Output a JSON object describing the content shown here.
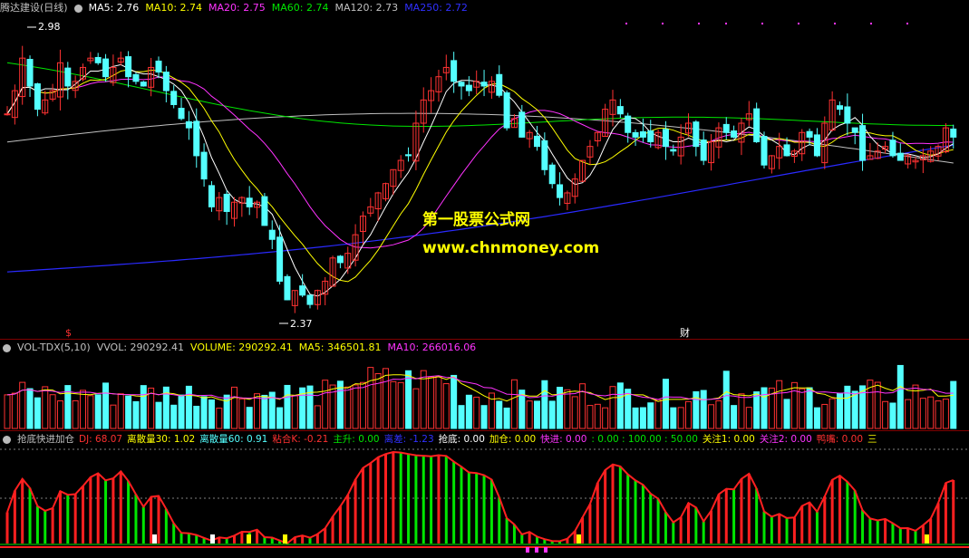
{
  "colors": {
    "up": "#ff3232",
    "down": "#54ffff",
    "white": "#ffffff",
    "yellow": "#ffff00",
    "magenta": "#ff33ff",
    "green": "#00e600",
    "blue": "#2a2aff",
    "grid": "#7f0000",
    "red": "#ff2020",
    "gray": "#c0c0c0"
  },
  "main": {
    "stock": "腾达建设(日线)",
    "ma_labels": [
      "MA5: 2.76",
      "MA10: 2.74",
      "MA20: 2.75",
      "MA60: 2.74",
      "MA120: 2.73",
      "MA250: 2.72"
    ],
    "high_label": "2.98",
    "low_label": "2.37",
    "marker_s": "$",
    "marker_cai": "财",
    "watermark_cn": "第一股票公式网",
    "watermark_url": "www.chnmoney.com"
  },
  "vol": {
    "name": "VOL-TDX(5,10)",
    "labels": [
      "VVOL: 290292.41",
      "VOLUME: 290292.41",
      "MA5: 346501.81",
      "MA10: 266016.06"
    ]
  },
  "ind": {
    "name": "抢底快进加仓",
    "labels": [
      "DJ: 68.07",
      "离散量30: 1.02",
      "离散量60: 0.91",
      "粘合K: -0.21",
      "主升: 0.00",
      "离差: -1.23",
      "抢底: 0.00",
      "加仓: 0.00",
      "快进: 0.00",
      ": 0.00 : 100.00 : 50.00",
      "关注1: 0.00",
      "关注2: 0.00",
      "鸭嘴: 0.00",
      "三"
    ]
  },
  "chart_data": {
    "type": "candlestick",
    "price_range": [
      2.33,
      3.02
    ],
    "high": 2.98,
    "low": 2.37,
    "closes": [
      2.81,
      2.86,
      2.93,
      2.87,
      2.82,
      2.84,
      2.86,
      2.92,
      2.87,
      2.88,
      2.91,
      2.93,
      2.92,
      2.89,
      2.91,
      2.93,
      2.89,
      2.88,
      2.87,
      2.91,
      2.9,
      2.86,
      2.83,
      2.8,
      2.78,
      2.72,
      2.67,
      2.61,
      2.63,
      2.6,
      2.62,
      2.63,
      2.61,
      2.62,
      2.57,
      2.54,
      2.45,
      2.41,
      2.43,
      2.42,
      2.4,
      2.43,
      2.45,
      2.5,
      2.49,
      2.51,
      2.55,
      2.59,
      2.61,
      2.64,
      2.66,
      2.69,
      2.71,
      2.72,
      2.79,
      2.84,
      2.86,
      2.89,
      2.91,
      2.88,
      2.87,
      2.86,
      2.88,
      2.87,
      2.88,
      2.85,
      2.78,
      2.8,
      2.76,
      2.77,
      2.74,
      2.69,
      2.66,
      2.63,
      2.64,
      2.67,
      2.71,
      2.74,
      2.77,
      2.82,
      2.84,
      2.81,
      2.77,
      2.76,
      2.76,
      2.75,
      2.77,
      2.74,
      2.73,
      2.76,
      2.79,
      2.74,
      2.71,
      2.75,
      2.78,
      2.77,
      2.76,
      2.79,
      2.81,
      2.75,
      2.7,
      2.72,
      2.74,
      2.72,
      2.73,
      2.77,
      2.76,
      2.72,
      2.79,
      2.84,
      2.82,
      2.79,
      2.77,
      2.71,
      2.72,
      2.73,
      2.74,
      2.72,
      2.71,
      2.72,
      2.71,
      2.72,
      2.73,
      2.74,
      2.78,
      2.76
    ]
  }
}
